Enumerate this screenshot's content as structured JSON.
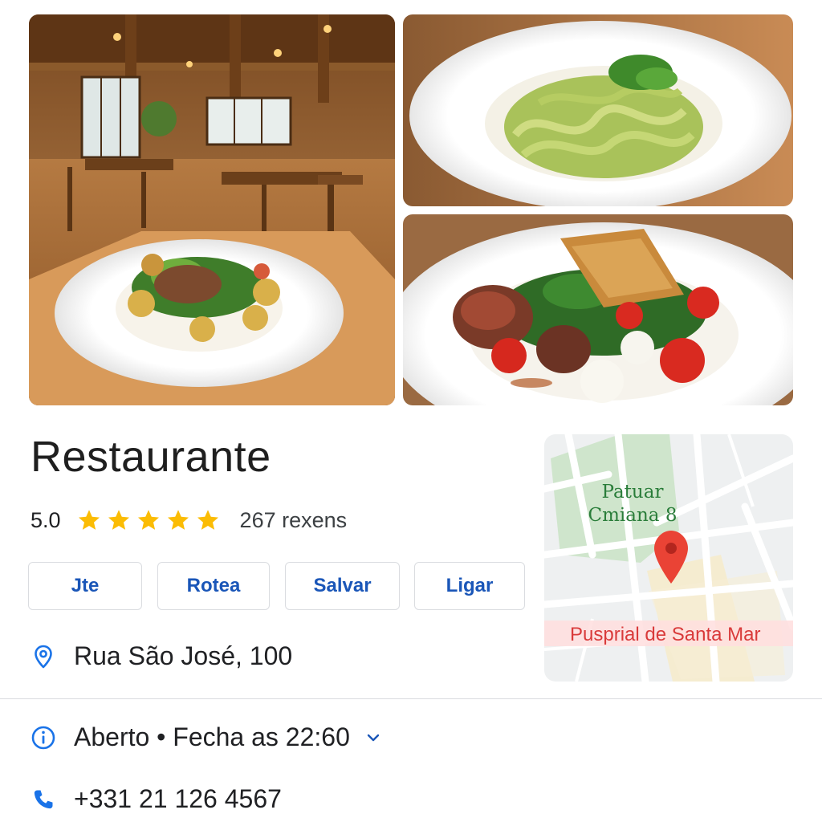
{
  "place": {
    "name": "Restaurante",
    "rating": "5.0",
    "stars": 5,
    "reviews": "267 rexens"
  },
  "actions": [
    {
      "label": "Jte"
    },
    {
      "label": "Rotea"
    },
    {
      "label": "Salvar"
    },
    {
      "label": "Ligar"
    }
  ],
  "address": "Rua São José, 100",
  "hours": "Aberto • Fecha as 22:60",
  "phone": "+331 21 126 4567",
  "map": {
    "park_label_line1": "Patuar",
    "park_label_line2": "Cmiana 8",
    "street_label": "Pusprial de Santa Mar"
  },
  "colors": {
    "accent_blue": "#1a56b8",
    "star_gold": "#fbbc04",
    "pin_red": "#ea4335",
    "divider": "#dadce0"
  },
  "icons": {
    "address": "location-pin-icon",
    "hours": "info-icon",
    "phone": "phone-icon"
  }
}
